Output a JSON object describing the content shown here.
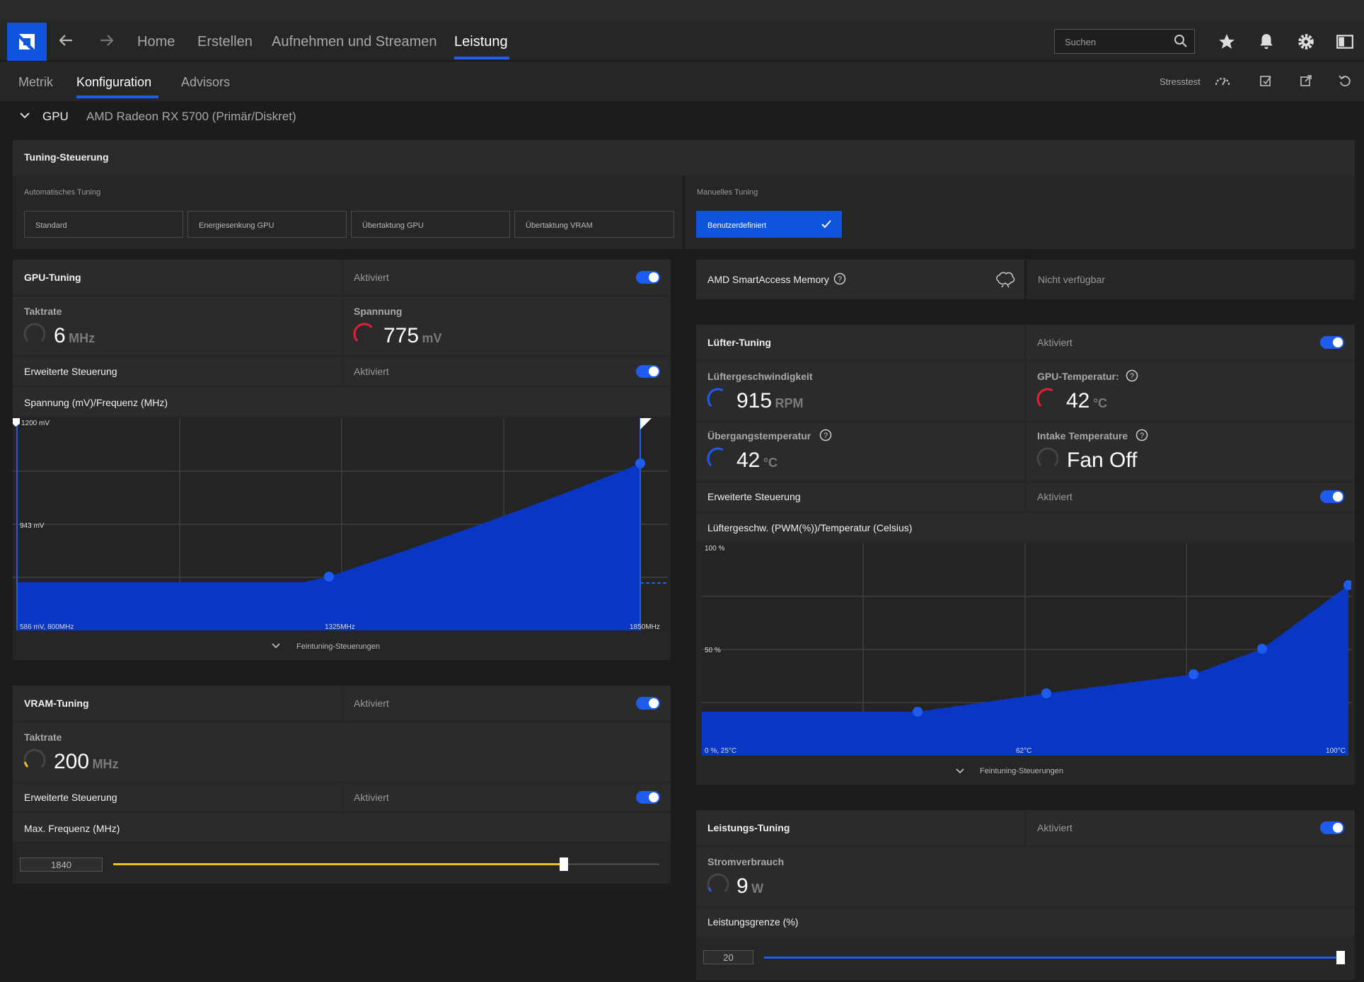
{
  "nav": {
    "home": "Home",
    "create": "Erstellen",
    "record": "Aufnehmen und Streamen",
    "performance": "Leistung",
    "search_placeholder": "Suchen"
  },
  "subnav": {
    "metrics": "Metrik",
    "config": "Konfiguration",
    "advisors": "Advisors",
    "stresstest": "Stresstest"
  },
  "gpu_header": {
    "label": "GPU",
    "name": "AMD Radeon RX 5700 (Primär/Diskret)"
  },
  "tuning_control": {
    "title": "Tuning-Steuerung",
    "auto_label": "Automatisches Tuning",
    "manual_label": "Manuelles Tuning",
    "auto_buttons": [
      "Standard",
      "Energiesenkung GPU",
      "Übertaktung GPU",
      "Übertaktung VRAM"
    ],
    "manual_button": "Benutzerdefiniert"
  },
  "gpu_tuning": {
    "title": "GPU-Tuning",
    "status": "Aktiviert",
    "clock_label": "Taktrate",
    "clock_value": "6",
    "clock_unit": "MHz",
    "voltage_label": "Spannung",
    "voltage_value": "775",
    "voltage_unit": "mV",
    "advanced_label": "Erweiterte Steuerung",
    "advanced_status": "Aktiviert",
    "curve_label": "Spannung (mV)/Frequenz (MHz)",
    "y_top": "1200 mV",
    "y_mid": "943 mV",
    "x_left": "586 mV, 800MHz",
    "x_mid": "1325MHz",
    "x_right": "1850MHz",
    "fine_tune": "Feintuning-Steuerungen"
  },
  "vram_tuning": {
    "title": "VRAM-Tuning",
    "status": "Aktiviert",
    "clock_label": "Taktrate",
    "clock_value": "200",
    "clock_unit": "MHz",
    "advanced_label": "Erweiterte Steuerung",
    "advanced_status": "Aktiviert",
    "max_freq_label": "Max. Frequenz (MHz)",
    "max_freq_value": "1840",
    "slider_fraction": 0.825
  },
  "sam": {
    "label": "AMD SmartAccess Memory",
    "status": "Nicht verfügbar"
  },
  "fan_tuning": {
    "title": "Lüfter-Tuning",
    "status": "Aktiviert",
    "fan_speed_label": "Lüftergeschwindigkeit",
    "fan_speed_value": "915",
    "fan_speed_unit": "RPM",
    "gpu_temp_label": "GPU-Temperatur:",
    "gpu_temp_value": "42",
    "gpu_temp_unit": "°C",
    "junction_label": "Übergangstemperatur",
    "junction_value": "42",
    "junction_unit": "°C",
    "intake_label": "Intake Temperature",
    "intake_value": "Fan Off",
    "advanced_label": "Erweiterte Steuerung",
    "advanced_status": "Aktiviert",
    "curve_label": "Lüftergeschw. (PWM(%))/Temperatur (Celsius)",
    "y_top": "100 %",
    "y_mid": "50 %",
    "x_left": "0 %, 25°C",
    "x_mid": "62°C",
    "x_right": "100°C",
    "fine_tune": "Feintuning-Steuerungen"
  },
  "power_tuning": {
    "title": "Leistungs-Tuning",
    "status": "Aktiviert",
    "power_label": "Stromverbrauch",
    "power_value": "9",
    "power_unit": "W",
    "limit_label": "Leistungsgrenze (%)",
    "limit_value": "20",
    "slider_fraction": 1.0
  },
  "colors": {
    "accent": "#1e5cf0",
    "curve_fill": "#0a36c4",
    "slider_vram": "#f0c020",
    "gauge_red": "#e0203a"
  }
}
